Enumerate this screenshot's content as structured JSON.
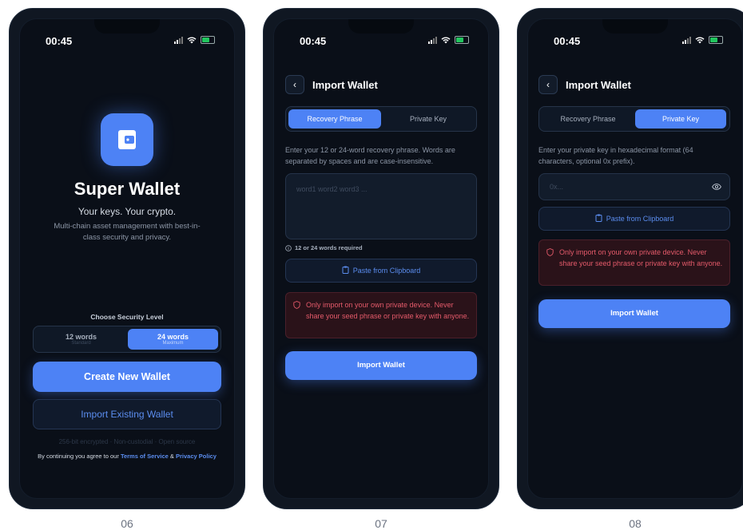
{
  "status": {
    "time": "00:45"
  },
  "screen06": {
    "app_name": "Super Wallet",
    "tagline": "Your keys. Your crypto.",
    "description": "Multi-chain asset management with best-in-class security and privacy.",
    "security_heading": "Choose Security Level",
    "option12_title": "12 words",
    "option12_sub": "Standard",
    "option24_title": "24 words",
    "option24_sub": "Maximum",
    "create_label": "Create New Wallet",
    "import_label": "Import Existing Wallet",
    "features": "256-bit encrypted · Non-custodial · Open source",
    "terms_prefix": "By continuing you agree to our ",
    "terms_link": "Terms of Service",
    "terms_and": " & ",
    "privacy_link": "Privacy Policy"
  },
  "screen07": {
    "title": "Import Wallet",
    "tab_phrase": "Recovery Phrase",
    "tab_key": "Private Key",
    "instructions": "Enter your 12 or 24-word recovery phrase. Words are separated by spaces and are case-insensitive.",
    "phrase_placeholder": "word1 word2 word3 ...",
    "hint": "12 or 24 words required",
    "paste_label": "Paste from Clipboard",
    "warning": "Only import on your own private device. Never share your seed phrase or private key with anyone.",
    "import_label": "Import Wallet"
  },
  "screen08": {
    "title": "Import Wallet",
    "tab_phrase": "Recovery Phrase",
    "tab_key": "Private Key",
    "instructions": "Enter your private key in hexadecimal format (64 characters, optional 0x prefix).",
    "key_placeholder": "0x...",
    "paste_label": "Paste from Clipboard",
    "warning": "Only import on your own private device. Never share your seed phrase or private key with anyone.",
    "import_label": "Import Wallet"
  },
  "captions": [
    "06",
    "07",
    "08"
  ],
  "colors": {
    "accent": "#4d82f5",
    "background": "#0a0f18",
    "danger": "#e55a6a"
  }
}
